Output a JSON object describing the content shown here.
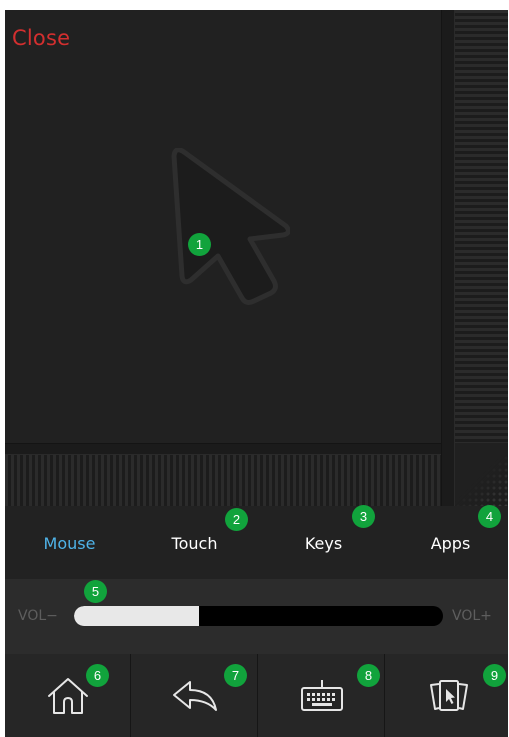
{
  "header": {
    "close_label": "Close"
  },
  "tabs": [
    {
      "label": "Mouse",
      "active": true
    },
    {
      "label": "Touch",
      "active": false
    },
    {
      "label": "Keys",
      "active": false
    },
    {
      "label": "Apps",
      "active": false
    }
  ],
  "volume": {
    "minus_label": "VOL−",
    "plus_label": "VOL+",
    "level_fraction": 0.34
  },
  "nav": {
    "home_icon": "home-icon",
    "back_icon": "back-icon",
    "keyboard_icon": "keyboard-icon",
    "apps_icon": "cards-icon"
  },
  "markers": [
    "1",
    "2",
    "3",
    "4",
    "5",
    "6",
    "7",
    "8",
    "9"
  ],
  "colors": {
    "background": "#1f1f1f",
    "close": "#d32f2f",
    "active_tab": "#4fb3e8",
    "tab_text": "#ffffff",
    "marker": "#11a33c",
    "vol_fill": "#e8e8e8",
    "vol_track": "#000000"
  }
}
